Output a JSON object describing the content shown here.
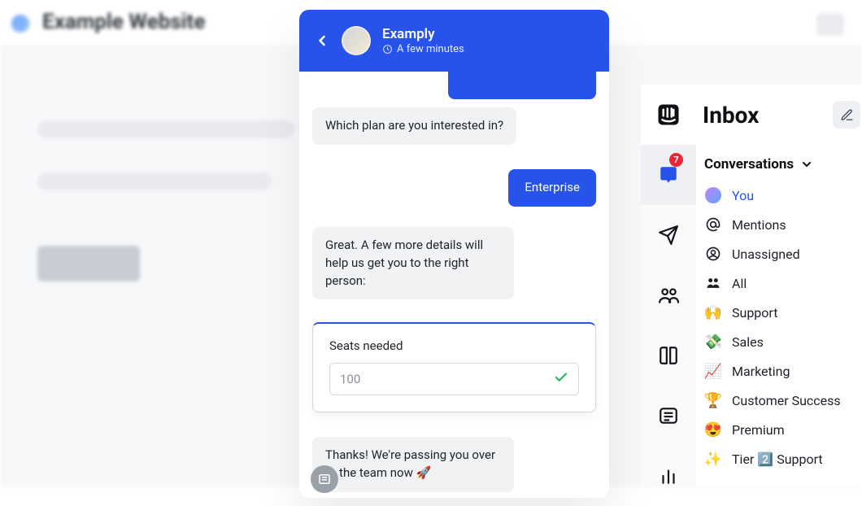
{
  "background": {
    "site_title": "Example Website"
  },
  "chat": {
    "agent_name": "Examply",
    "response_time": "A few minutes",
    "messages": {
      "bot_plan_q": "Which plan are you interested in?",
      "user_plan_a": "Enterprise",
      "bot_details": "Great. A few more details will help us get you to the right person:",
      "bot_handoff": "Thanks! We're passing you over to the team now 🚀"
    },
    "form": {
      "seats_label": "Seats needed",
      "seats_value": "100"
    }
  },
  "inbox": {
    "title": "Inbox",
    "badge": "7",
    "section": "Conversations",
    "items": {
      "you": "You",
      "mentions": "Mentions",
      "unassigned": "Unassigned",
      "all": "All",
      "support": "Support",
      "sales": "Sales",
      "marketing": "Marketing",
      "cs": "Customer Success",
      "premium": "Premium",
      "tier2": "Tier 2️⃣ Support"
    }
  }
}
